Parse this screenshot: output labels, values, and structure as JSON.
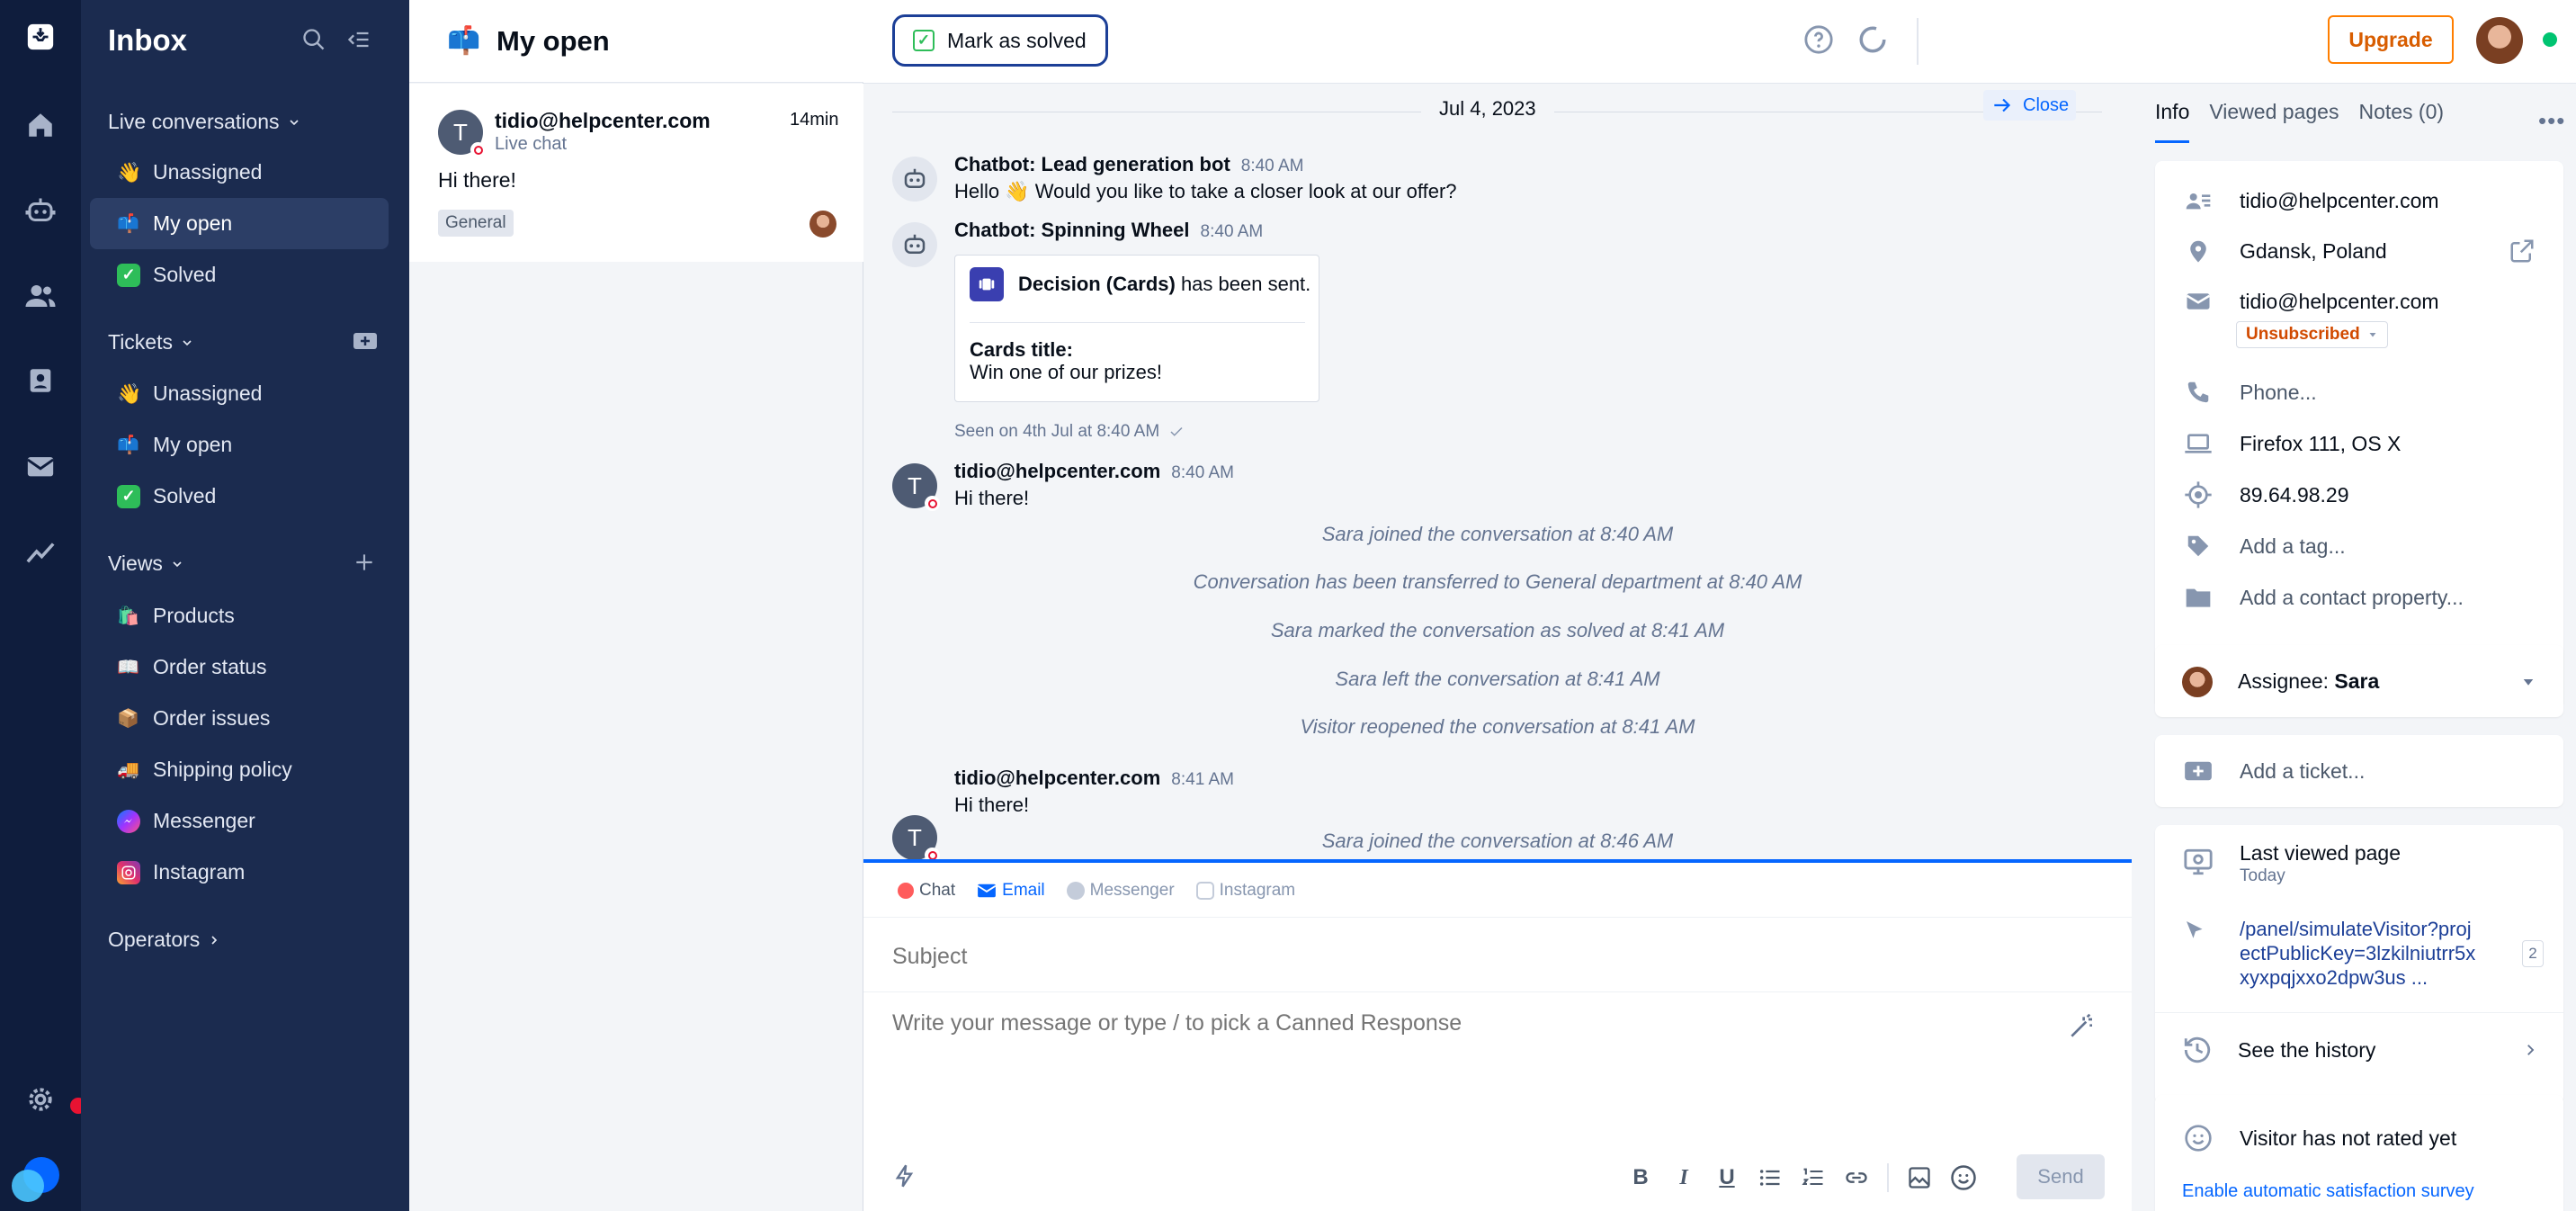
{
  "rail": {
    "items": [
      "inbox-icon",
      "home-icon",
      "bot-icon",
      "contacts-icon",
      "tickets-icon",
      "mail-icon",
      "analytics-icon"
    ],
    "settings_icon": "gear-icon",
    "brand_icon": "tidio-logo"
  },
  "sidebar": {
    "title": "Inbox",
    "live": {
      "label": "Live conversations",
      "items": [
        {
          "emoji": "wave",
          "label": "Unassigned"
        },
        {
          "emoji": "mailbox",
          "label": "My open"
        },
        {
          "emoji": "check",
          "label": "Solved"
        }
      ]
    },
    "tickets": {
      "label": "Tickets",
      "items": [
        {
          "emoji": "wave",
          "label": "Unassigned"
        },
        {
          "emoji": "mailbox",
          "label": "My open"
        },
        {
          "emoji": "check",
          "label": "Solved"
        }
      ]
    },
    "views": {
      "label": "Views",
      "items": [
        {
          "emoji": "bag",
          "label": "Products"
        },
        {
          "emoji": "book",
          "label": "Order status"
        },
        {
          "emoji": "box",
          "label": "Order issues"
        },
        {
          "emoji": "truck",
          "label": "Shipping policy"
        },
        {
          "emoji": "messenger",
          "label": "Messenger"
        },
        {
          "emoji": "instagram",
          "label": "Instagram"
        }
      ]
    },
    "operators_label": "Operators"
  },
  "convlist": {
    "title": "My open",
    "card": {
      "avatar_letter": "T",
      "email": "tidio@helpcenter.com",
      "channel": "Live chat",
      "age": "14min",
      "preview": "Hi there!",
      "tag": "General"
    }
  },
  "chat": {
    "mark_solved": "Mark as solved",
    "date": "Jul 4, 2023",
    "close": "Close",
    "messages": [
      {
        "name": "Chatbot: Lead generation bot",
        "time": "8:40 AM",
        "text": "Hello 👋 Would you like to take a closer look at our offer?"
      },
      {
        "name": "Chatbot: Spinning Wheel",
        "time": "8:40 AM"
      }
    ],
    "decision": {
      "bold": "Decision (Cards)",
      "rest": " has been sent.",
      "cards_title_label": "Cards title:",
      "cards_title_value": "Win one of our prizes!"
    },
    "seen": "Seen on 4th Jul at 8:40 AM",
    "visitor1": {
      "letter": "T",
      "name": "tidio@helpcenter.com",
      "time": "8:40 AM",
      "text": "Hi there!"
    },
    "system": [
      "Sara joined the conversation at 8:40 AM",
      "Conversation has been transferred to General department at 8:40 AM",
      "Sara marked the conversation as solved at 8:41 AM",
      "Sara left the conversation at 8:41 AM",
      "Visitor reopened the conversation at 8:41 AM"
    ],
    "visitor2": {
      "letter": "T",
      "name": "tidio@helpcenter.com",
      "time": "8:41 AM",
      "text": "Hi there!"
    },
    "system_last": "Sara joined the conversation at 8:46 AM"
  },
  "composer": {
    "channels": [
      "Chat",
      "Email",
      "Messenger",
      "Instagram"
    ],
    "active_channel": "Email",
    "subject_placeholder": "Subject",
    "message_placeholder": "Write your message or type / to pick a Canned Response",
    "send": "Send"
  },
  "topbar": {
    "upgrade": "Upgrade"
  },
  "right": {
    "tabs": [
      "Info",
      "Viewed pages",
      "Notes (0)"
    ],
    "active_tab": "Info",
    "info": {
      "name": "tidio@helpcenter.com",
      "location": "Gdansk, Poland",
      "email": "tidio@helpcenter.com",
      "subscription": "Unsubscribed",
      "phone_placeholder": "Phone...",
      "browser": "Firefox 111, OS X",
      "ip": "89.64.98.29",
      "tag_placeholder": "Add a tag...",
      "property_placeholder": "Add a contact property..."
    },
    "assignee": {
      "label": "Assignee:",
      "name": "Sara"
    },
    "ticket": "Add a ticket...",
    "last_viewed": {
      "title": "Last viewed page",
      "sub": "Today",
      "url_line1": "/panel/simulateVisitor?proj",
      "url_line2": "ectPublicKey=3lzkilniutrr5x",
      "url_line3": "xyxpqjxxo2dpw3us ...",
      "count": "2",
      "history": "See the history"
    },
    "rating": {
      "text": "Visitor has not rated yet",
      "link": "Enable automatic satisfaction survey"
    }
  },
  "colors": {
    "rail": "#0f1d3d",
    "sidebar": "#1b2b4f",
    "accent": "#0566ff",
    "upgrade": "#ff7e00",
    "online": "#00c471",
    "unsub": "#d14a00"
  }
}
